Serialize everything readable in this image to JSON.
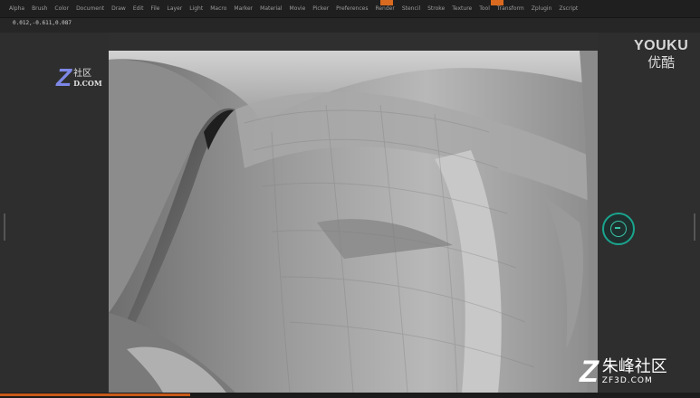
{
  "menu": {
    "items": [
      "Alpha",
      "Brush",
      "Color",
      "Document",
      "Draw",
      "Edit",
      "File",
      "Layer",
      "Light",
      "Macro",
      "Marker",
      "Material",
      "Movie",
      "Picker",
      "Preferences",
      "Render",
      "Stencil",
      "Stroke",
      "Texture",
      "Tool",
      "Transform",
      "Zplugin",
      "Zscript"
    ]
  },
  "status": {
    "coordinates": "0.012,-0.611,0.087"
  },
  "watermarks": {
    "youku_en": "YOUKU",
    "youku_cn": "优酷",
    "zf_top_letter": "Z",
    "zf_top_cn": "社区",
    "zf_top_en": "D.COM",
    "zf_bottom_letter": "Z",
    "zf_bottom_cn": "朱峰社区",
    "zf_bottom_en": "ZF3D.COM"
  },
  "colors": {
    "accent_orange": "#d96a1f",
    "floating_button": "#1aa58e",
    "zf_logo_blue": "#7d87e6"
  },
  "icons": {
    "floating_control": "navigation-ring-icon"
  }
}
